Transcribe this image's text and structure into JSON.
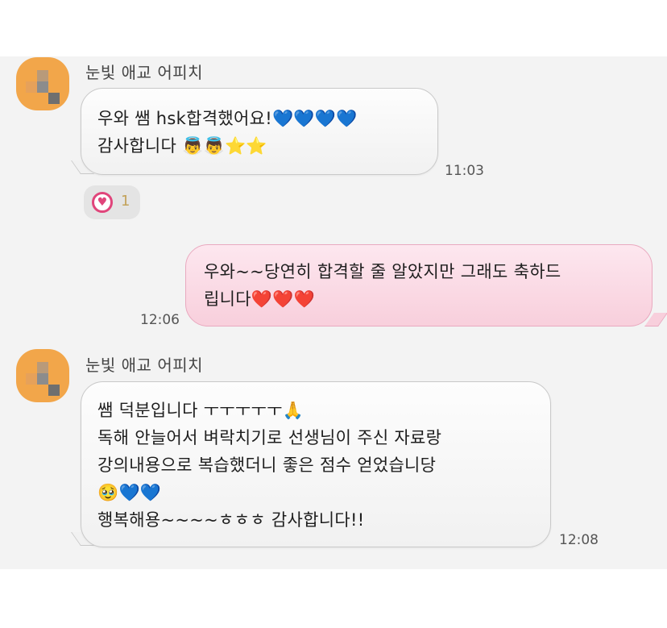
{
  "messages": [
    {
      "sender": "눈빛 애교 어피치",
      "lines": [
        "우와 쌤 hsk합격했어요!💙💙💙💙",
        "감사합니다 👼👼⭐⭐"
      ],
      "time": "11:03",
      "reaction": {
        "icon": "heart",
        "count": "1"
      }
    },
    {
      "lines": [
        "우와~~당연히 합격할 줄 알았지만 그래도 축하드",
        "립니다❤️❤️❤️"
      ],
      "time": "12:06"
    },
    {
      "sender": "눈빛 애교 어피치",
      "lines": [
        "쌤 덕분입니다 ㅜㅜㅜㅜㅜ🙏",
        "독해 안늘어서 벼락치기로 선생님이 주신 자료랑",
        "강의내용으로 복습했더니 좋은 점수 얻었습니당",
        "🥹💙💙",
        "행복해용~~~~ㅎㅎㅎ 감사합니다!!"
      ],
      "time": "12:08"
    }
  ],
  "colors": {
    "chat_bg": "#f3f3f3",
    "incoming_bubble": "#f1f1f1",
    "outgoing_bubble": "#f8cfdc",
    "avatar": "#f2a64a"
  }
}
